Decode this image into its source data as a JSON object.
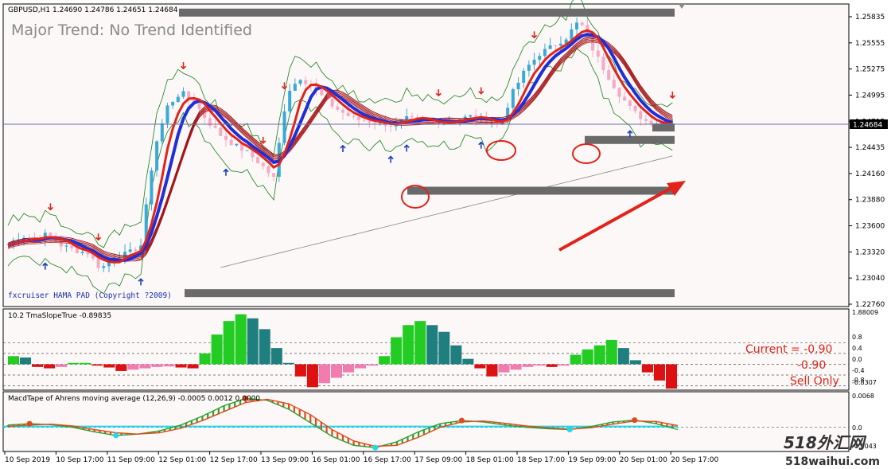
{
  "window": {
    "symbol_header": "GBPUSD,H1  1.24690 1.24786 1.24651 1.24684",
    "trend_label": "Major Trend: No Trend Identified",
    "indicator_credit": "fxcruiser HAMA PAD (Copyright ?2009)",
    "watermark_top": "518外汇网",
    "watermark_bottom": "518waihui.com"
  },
  "colors": {
    "bg": "#ffffff",
    "plot_bg": "#fbf8f7",
    "grid_border": "#000000",
    "bull_candle": "#3aa9d6",
    "bear_candle": "#f7a9c4",
    "ma_red": "#e2231a",
    "ma_blue": "#1f2fd8",
    "ma_darkred": "#8b0000",
    "envelope": "#1a7f1a",
    "sr_bar": "#6a6a6a",
    "arrow_up": "#1a3fc4",
    "arrow_down": "#e2231a",
    "annot_red": "#e2231a",
    "hist_green": "#22cc22",
    "hist_teal": "#1f7f7f",
    "hist_red": "#dd1111",
    "hist_pink": "#f27cb0",
    "macd_green": "#2e9e2e",
    "macd_red": "#e04a1a",
    "macd_cyan": "#20d8f0"
  },
  "chart_data": [
    {
      "type": "line",
      "title": "GBPUSD,H1",
      "y_ticks": [
        "1.25835",
        "1.25555",
        "1.25275",
        "1.24995",
        "1.24715",
        "1.24435",
        "1.24160",
        "1.23880",
        "1.23600",
        "1.23320",
        "1.23040",
        "1.22760"
      ],
      "current_price_label": "1.24684",
      "ylim": [
        1.2276,
        1.2592
      ],
      "series": [
        {
          "name": "close",
          "x": [
            0,
            2,
            4,
            6,
            8,
            10,
            12,
            14,
            16,
            18,
            20,
            22,
            24,
            26,
            28,
            30,
            32,
            34,
            36,
            38,
            40,
            42,
            44,
            46,
            48,
            50,
            52,
            54,
            56,
            58,
            60,
            62,
            64,
            66,
            68,
            70,
            72,
            74,
            76,
            78,
            80,
            82,
            84,
            86,
            88,
            90,
            92,
            94,
            96,
            98,
            100
          ],
          "y": [
            1.234,
            1.235,
            1.2346,
            1.2352,
            1.234,
            1.2335,
            1.2332,
            1.2315,
            1.2329,
            1.2331,
            1.234,
            1.244,
            1.2485,
            1.25,
            1.249,
            1.247,
            1.2455,
            1.2445,
            1.2437,
            1.2425,
            1.241,
            1.25,
            1.2515,
            1.2505,
            1.249,
            1.248,
            1.2472,
            1.247,
            1.2468,
            1.2465,
            1.2472,
            1.247,
            1.2468,
            1.247,
            1.2472,
            1.2475,
            1.247,
            1.2465,
            1.25,
            1.2525,
            1.254,
            1.2548,
            1.2557,
            1.2575,
            1.2545,
            1.252,
            1.2498,
            1.248,
            1.247,
            1.2468,
            1.2468
          ]
        }
      ],
      "support_resistance_levels": [
        1.2583,
        1.245,
        1.2397,
        1.229,
        1.2463
      ],
      "arrows_down_x": [
        8,
        17,
        33,
        48,
        52,
        81,
        89,
        99,
        125
      ],
      "arrows_up_x": [
        7,
        25,
        41,
        63,
        72,
        75,
        89,
        117
      ]
    },
    {
      "type": "bar",
      "title": "10.2 TmaSlopeTrue -0.89835",
      "y_ticks": [
        "1.88009",
        "0.8",
        "0.4",
        "0.0",
        "-0.4",
        "-0.8",
        "-0.8307"
      ],
      "annotations": [
        "Current = -0.90",
        "-0.90",
        "Sell Only"
      ],
      "values": [
        0.3,
        0.25,
        -0.1,
        -0.15,
        -0.1,
        0.05,
        0.05,
        -0.05,
        -0.12,
        -0.25,
        -0.2,
        -0.15,
        -0.1,
        -0.08,
        -0.12,
        -0.15,
        0.4,
        1.1,
        1.6,
        1.85,
        1.7,
        1.3,
        0.6,
        0.05,
        -0.45,
        -0.85,
        -0.7,
        -0.5,
        -0.3,
        -0.15,
        -0.05,
        0.3,
        1.0,
        1.45,
        1.6,
        1.45,
        1.2,
        0.7,
        0.2,
        -0.15,
        -0.45,
        -0.3,
        -0.2,
        -0.1,
        -0.05,
        -0.1,
        -0.05,
        0.35,
        0.55,
        0.7,
        0.9,
        0.6,
        0.15,
        -0.3,
        -0.6,
        -0.9
      ],
      "ylim": [
        -0.9,
        1.9
      ]
    },
    {
      "type": "line",
      "title": "MacdTape of Ahrens moving average (12,26,9) -0.0005 0.0012 0.0000",
      "y_ticks": [
        "0.0068",
        "0.0",
        "-0.0043"
      ],
      "ylim": [
        -0.005,
        0.007
      ],
      "series": [
        {
          "name": "macd",
          "values": [
            0.0005,
            0.0008,
            0.0006,
            0.0,
            -0.001,
            -0.0018,
            -0.0015,
            -0.0008,
            0.0005,
            0.0025,
            0.0048,
            0.0064,
            0.006,
            0.004,
            0.001,
            -0.002,
            -0.004,
            -0.0045,
            -0.0032,
            -0.001,
            0.0008,
            0.0015,
            0.0012,
            0.0005,
            0.0,
            -0.0003,
            -0.0005,
            0.0002,
            0.0012,
            0.0016,
            0.0008,
            -0.0005
          ]
        },
        {
          "name": "signal",
          "values": [
            0.0002,
            0.0005,
            0.0007,
            0.0003,
            -0.0005,
            -0.0012,
            -0.0015,
            -0.0012,
            -0.0002,
            0.0015,
            0.0035,
            0.0055,
            0.0062,
            0.0052,
            0.0028,
            -0.0005,
            -0.003,
            -0.0042,
            -0.004,
            -0.0022,
            0.0,
            0.0012,
            0.0014,
            0.0009,
            0.0003,
            -0.0001,
            -0.0004,
            -0.0001,
            0.0007,
            0.0014,
            0.0013,
            0.0004
          ]
        }
      ]
    }
  ],
  "x_labels": [
    "10 Sep 2019",
    "10 Sep 17:00",
    "11 Sep 09:00",
    "12 Sep 01:00",
    "12 Sep 17:00",
    "13 Sep 09:00",
    "16 Sep 01:00",
    "16 Sep 17:00",
    "17 Sep 09:00",
    "18 Sep 01:00",
    "18 Sep 17:00",
    "19 Sep 09:00",
    "20 Sep 01:00",
    "20 Sep 17:00"
  ]
}
